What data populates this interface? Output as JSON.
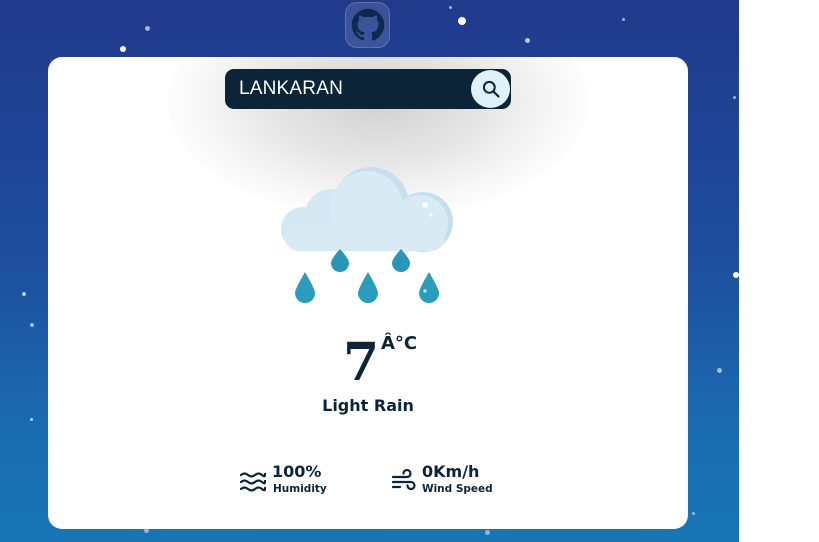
{
  "search": {
    "value": "LANKARAN",
    "button_icon": "search-icon"
  },
  "weather": {
    "icon": "rain-cloud-icon",
    "temperature": "7",
    "unit": "Â°C",
    "description": "Light Rain"
  },
  "stats": {
    "humidity": {
      "value": "100%",
      "label": "Humidity",
      "icon": "humidity-waves-icon"
    },
    "wind": {
      "value": "0Km/h",
      "label": "Wind Speed",
      "icon": "wind-icon"
    }
  },
  "header": {
    "github_icon": "github-icon"
  },
  "colors": {
    "background_top": "#213a8c",
    "background_bottom": "#1776b6",
    "card": "#ffffff",
    "dark_text": "#0c2438",
    "search_bg": "#0c2438",
    "search_button": "#dff2fb",
    "cloud": "#d6eaf5",
    "drop": "#2a9dbd"
  }
}
